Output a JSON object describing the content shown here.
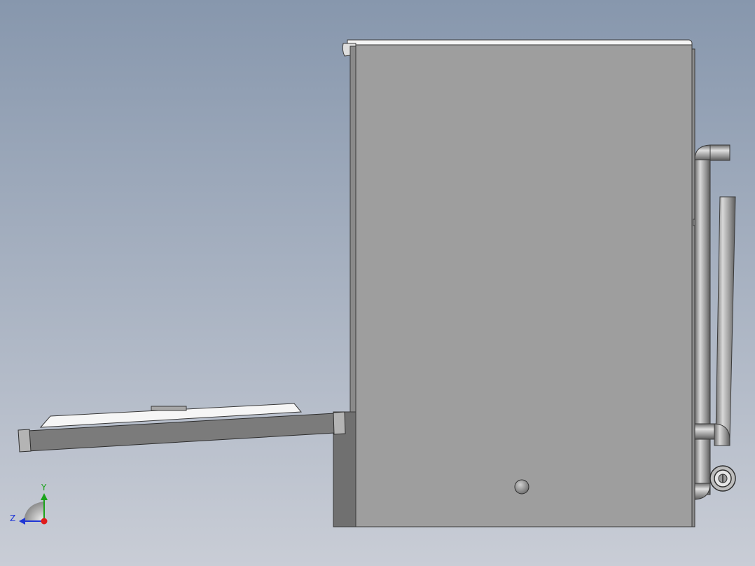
{
  "viewport": {
    "background": {
      "top": "#8797ad",
      "bottom": "#c9cdd6"
    }
  },
  "model": {
    "body_color": "#9e9e9e",
    "dark_color": "#6e6e6e",
    "edge_color": "#3a3a3a",
    "pipe_color": "#a9a9a9"
  },
  "triad": {
    "x_label": "Y",
    "z_label": "Z",
    "y_color": "#1aa31a",
    "z_color": "#1f36d6",
    "x_color": "#e01b1b"
  }
}
